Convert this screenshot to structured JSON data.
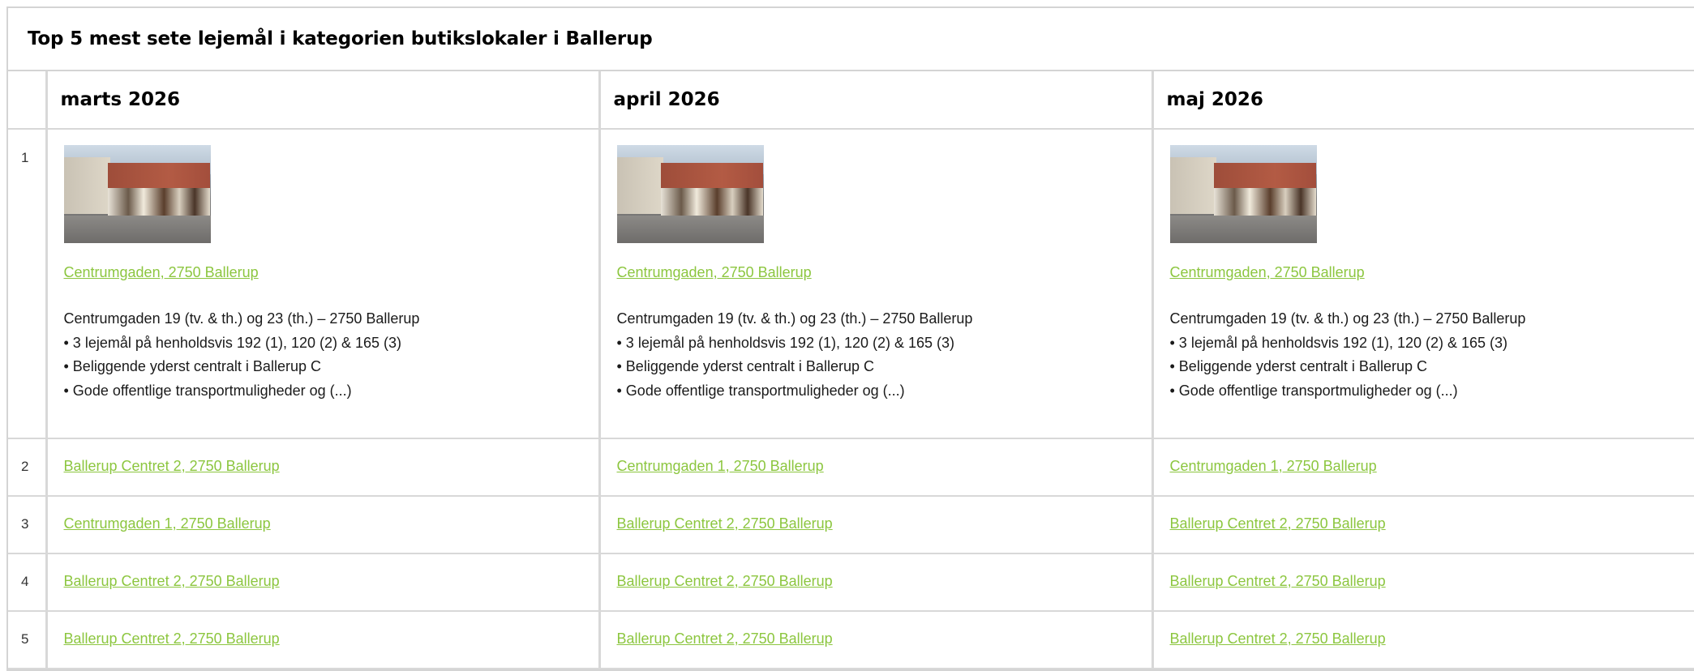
{
  "title": "Top 5 mest sete lejemål i kategorien butikslokaler i Ballerup",
  "months": [
    "marts 2026",
    "april 2026",
    "maj 2026"
  ],
  "featured": {
    "rank": "1",
    "cells": [
      {
        "link": "Centrumgaden, 2750 Ballerup",
        "lines": [
          "Centrumgaden 19 (tv. & th.) og 23 (th.) – 2750 Ballerup",
          "• 3 lejemål på henholdsvis 192 (1), 120 (2) & 165 (3)",
          "• Beliggende yderst centralt i Ballerup C",
          "• Gode offentlige transportmuligheder og (...)"
        ]
      },
      {
        "link": "Centrumgaden, 2750 Ballerup",
        "lines": [
          "Centrumgaden 19 (tv. & th.) og 23 (th.) – 2750 Ballerup",
          "• 3 lejemål på henholdsvis 192 (1), 120 (2) & 165 (3)",
          "• Beliggende yderst centralt i Ballerup C",
          "• Gode offentlige transportmuligheder og (...)"
        ]
      },
      {
        "link": "Centrumgaden, 2750 Ballerup",
        "lines": [
          "Centrumgaden 19 (tv. & th.) og 23 (th.) – 2750 Ballerup",
          "• 3 lejemål på henholdsvis 192 (1), 120 (2) & 165 (3)",
          "• Beliggende yderst centralt i Ballerup C",
          "• Gode offentlige transportmuligheder og (...)"
        ]
      }
    ]
  },
  "rows": [
    {
      "rank": "2",
      "cells": [
        "Ballerup Centret 2, 2750 Ballerup",
        "Centrumgaden 1, 2750 Ballerup",
        "Centrumgaden 1, 2750 Ballerup"
      ]
    },
    {
      "rank": "3",
      "cells": [
        "Centrumgaden 1, 2750 Ballerup",
        "Ballerup Centret 2, 2750 Ballerup",
        "Ballerup Centret 2, 2750 Ballerup"
      ]
    },
    {
      "rank": "4",
      "cells": [
        "Ballerup Centret 2, 2750 Ballerup",
        "Ballerup Centret 2, 2750 Ballerup",
        "Ballerup Centret 2, 2750 Ballerup"
      ]
    },
    {
      "rank": "5",
      "cells": [
        "Ballerup Centret 2, 2750 Ballerup",
        "Ballerup Centret 2, 2750 Ballerup",
        "Ballerup Centret 2, 2750 Ballerup"
      ]
    }
  ],
  "colors": {
    "link": "#8cc63f",
    "border": "#d8d8d8"
  }
}
